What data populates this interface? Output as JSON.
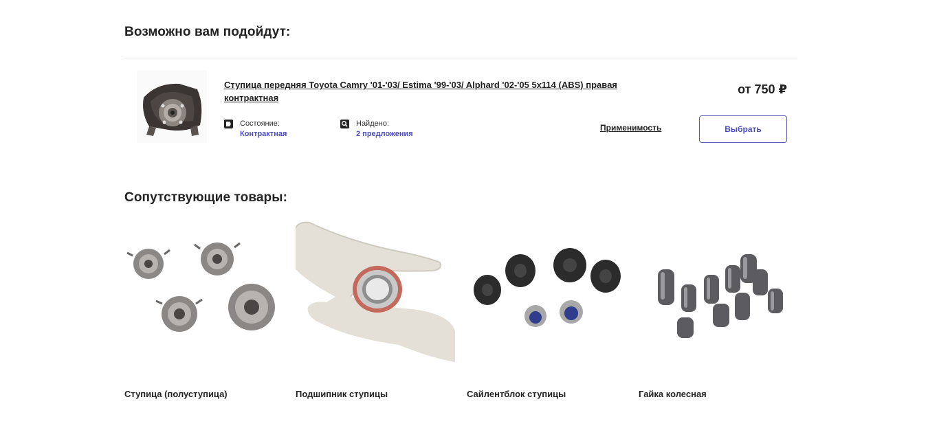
{
  "suggestions": {
    "title": "Возможно вам подойдут:",
    "item": {
      "title": "Ступица передняя Toyota Camry '01-'03/ Estima '99-'03/ Alphard '02-'05 5x114 (ABS) правая контрактная",
      "condition_label": "Состояние:",
      "condition_value": "Контрактная",
      "found_label": "Найдено:",
      "found_value": "2 предложения",
      "price": "от 750 ₽",
      "applicability_label": "Применимость",
      "select_label": "Выбрать",
      "icons": {
        "condition": "tag-icon",
        "found": "search-icon"
      }
    }
  },
  "related": {
    "title": "Сопутствующие товары:",
    "items": [
      {
        "name": "Ступица (полуступица)",
        "image": "wheel-hubs-image"
      },
      {
        "name": "Подшипник ступицы",
        "image": "bearing-in-hand-image"
      },
      {
        "name": "Сайлентблок ступицы",
        "image": "silent-blocks-image"
      },
      {
        "name": "Гайка колесная",
        "image": "wheel-nuts-image"
      }
    ]
  },
  "colors": {
    "accent": "#4c4cc0",
    "text": "#222222",
    "divider": "#e6e6e6"
  }
}
